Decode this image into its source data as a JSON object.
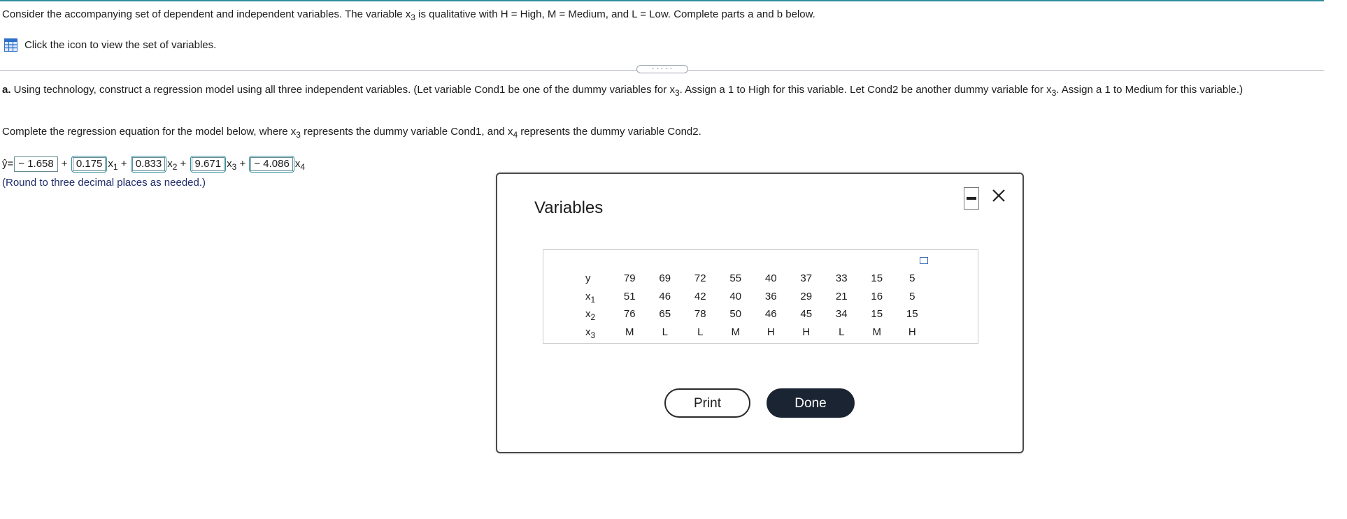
{
  "intro": {
    "text_before": "Consider the accompanying set of dependent and independent variables. The variable ",
    "var": "x",
    "var_sub": "3",
    "text_after": " is qualitative with H = High, M = Medium, and L = Low. Complete parts a and b below."
  },
  "view_link": {
    "icon": "table-grid-icon",
    "label": "Click the icon to view the set of variables."
  },
  "divider": {
    "grip": "....."
  },
  "part_a": {
    "label": "a.",
    "s1": " Using technology, construct a regression model using all three independent variables. (Let variable Cond1 be one of the dummy variables for ",
    "v1": "x",
    "v1sub": "3",
    "s2": ". Assign a 1 to High for this variable. Let Cond2 be another dummy variable for ",
    "v2": "x",
    "v2sub": "3",
    "s3": ". Assign a 1 to Medium for this variable.)"
  },
  "instruction": {
    "s1": "Complete the regression equation for the model below, where ",
    "v1": "x",
    "v1sub": "3",
    "s2": " represents the dummy variable Cond1, and ",
    "v2": "x",
    "v2sub": "4",
    "s3": " represents the dummy variable Cond2."
  },
  "equation": {
    "yhat": "ŷ",
    "eq": "=",
    "b0": "− 1.658",
    "b1": "0.175",
    "b2": "0.833",
    "b3": "9.671",
    "b4": "− 4.086",
    "plus": "+",
    "x": "x",
    "s1": "1",
    "s2": "2",
    "s3": "3",
    "s4": "4"
  },
  "round_note": "(Round to three decimal places as needed.)",
  "modal": {
    "title": "Variables",
    "minimize_icon": "minimize-icon",
    "close_icon": "close-icon",
    "copy_icon": "copy-icon",
    "rows": [
      {
        "label": "y",
        "sub": "",
        "values": [
          "79",
          "69",
          "72",
          "55",
          "40",
          "37",
          "33",
          "15",
          "5"
        ]
      },
      {
        "label": "x",
        "sub": "1",
        "values": [
          "51",
          "46",
          "42",
          "40",
          "36",
          "29",
          "21",
          "16",
          "5"
        ]
      },
      {
        "label": "x",
        "sub": "2",
        "values": [
          "76",
          "65",
          "78",
          "50",
          "46",
          "45",
          "34",
          "15",
          "15"
        ]
      },
      {
        "label": "x",
        "sub": "3",
        "values": [
          "M",
          "L",
          "L",
          "M",
          "H",
          "H",
          "L",
          "M",
          "H"
        ]
      }
    ],
    "print_label": "Print",
    "done_label": "Done"
  }
}
